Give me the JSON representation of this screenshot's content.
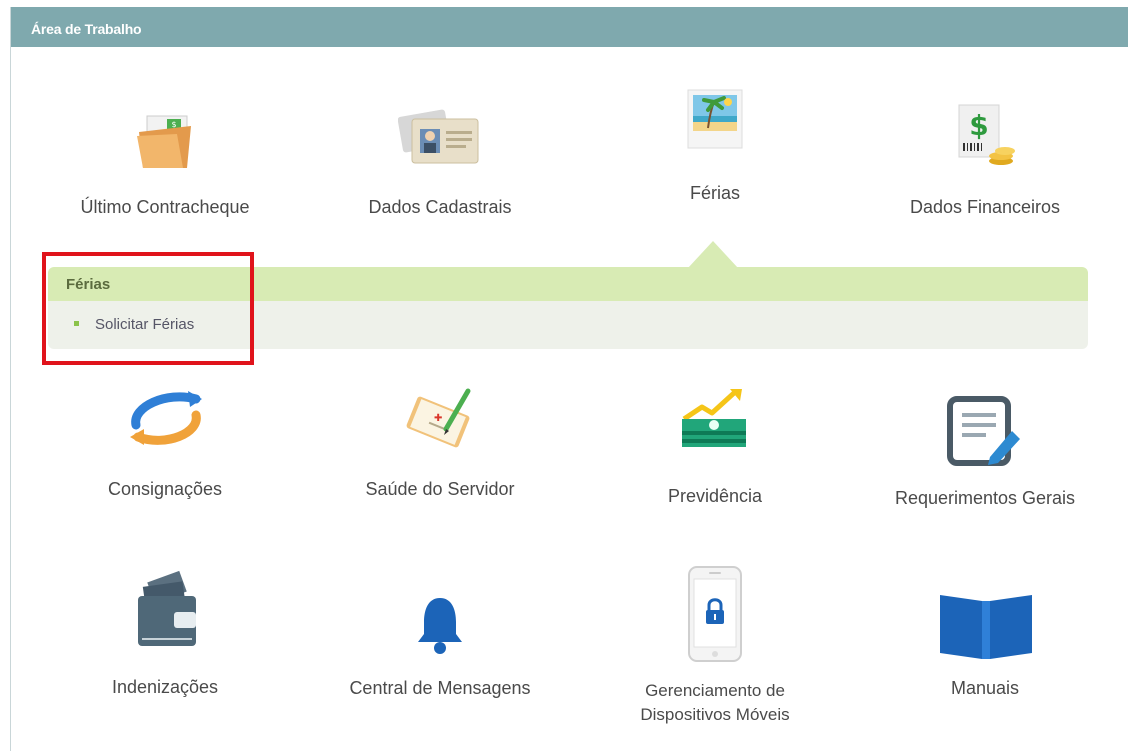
{
  "header": {
    "title": "Área de Trabalho"
  },
  "tiles": [
    {
      "label": "Último Contracheque",
      "icon": "folder-paycheck-icon"
    },
    {
      "label": "Dados Cadastrais",
      "icon": "id-cards-icon"
    },
    {
      "label": "Férias",
      "icon": "beach-photo-icon"
    },
    {
      "label": "Dados Financeiros",
      "icon": "dollar-coins-icon"
    },
    {
      "label": "Consignações",
      "icon": "circular-arrows-icon"
    },
    {
      "label": "Saúde do Servidor",
      "icon": "clipboard-pen-icon"
    },
    {
      "label": "Previdência",
      "icon": "money-growth-icon"
    },
    {
      "label": "Requerimentos Gerais",
      "icon": "document-edit-icon"
    },
    {
      "label": "Indenizações",
      "icon": "wallet-icon"
    },
    {
      "label": "Central de Mensagens",
      "icon": "bell-icon"
    },
    {
      "label_line1": "Gerenciamento de",
      "label_line2": "Dispositivos Móveis",
      "icon": "mobile-lock-icon"
    },
    {
      "label": "Manuais",
      "icon": "open-book-icon"
    }
  ],
  "submenu": {
    "title": "Férias",
    "items": [
      {
        "label": "Solicitar Férias"
      }
    ]
  },
  "colors": {
    "header_bg": "#7fa9ae",
    "submenu_head_bg": "#d8ebb4",
    "submenu_body_bg": "#eef1ea",
    "highlight_border": "#e0131b",
    "icon_blue": "#2d6ec9"
  }
}
